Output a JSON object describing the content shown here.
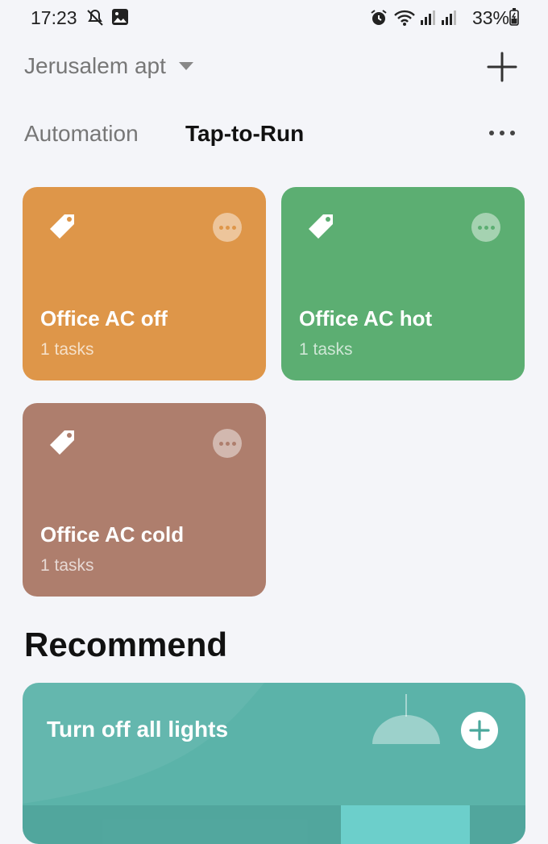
{
  "status_bar": {
    "time": "17:23",
    "battery": "33%"
  },
  "header": {
    "home_name": "Jerusalem apt"
  },
  "tabs": [
    {
      "label": "Automation"
    },
    {
      "label": "Tap-to-Run"
    }
  ],
  "scenes": [
    {
      "title": "Office AC off",
      "subtitle": "1 tasks",
      "color": "#de9649"
    },
    {
      "title": "Office AC hot",
      "subtitle": "1 tasks",
      "color": "#5cae72"
    },
    {
      "title": "Office AC cold",
      "subtitle": "1 tasks",
      "color": "#ae7e6d"
    }
  ],
  "recommend": {
    "heading": "Recommend",
    "card_title": "Turn off all lights",
    "color": "#5bb3a9"
  }
}
